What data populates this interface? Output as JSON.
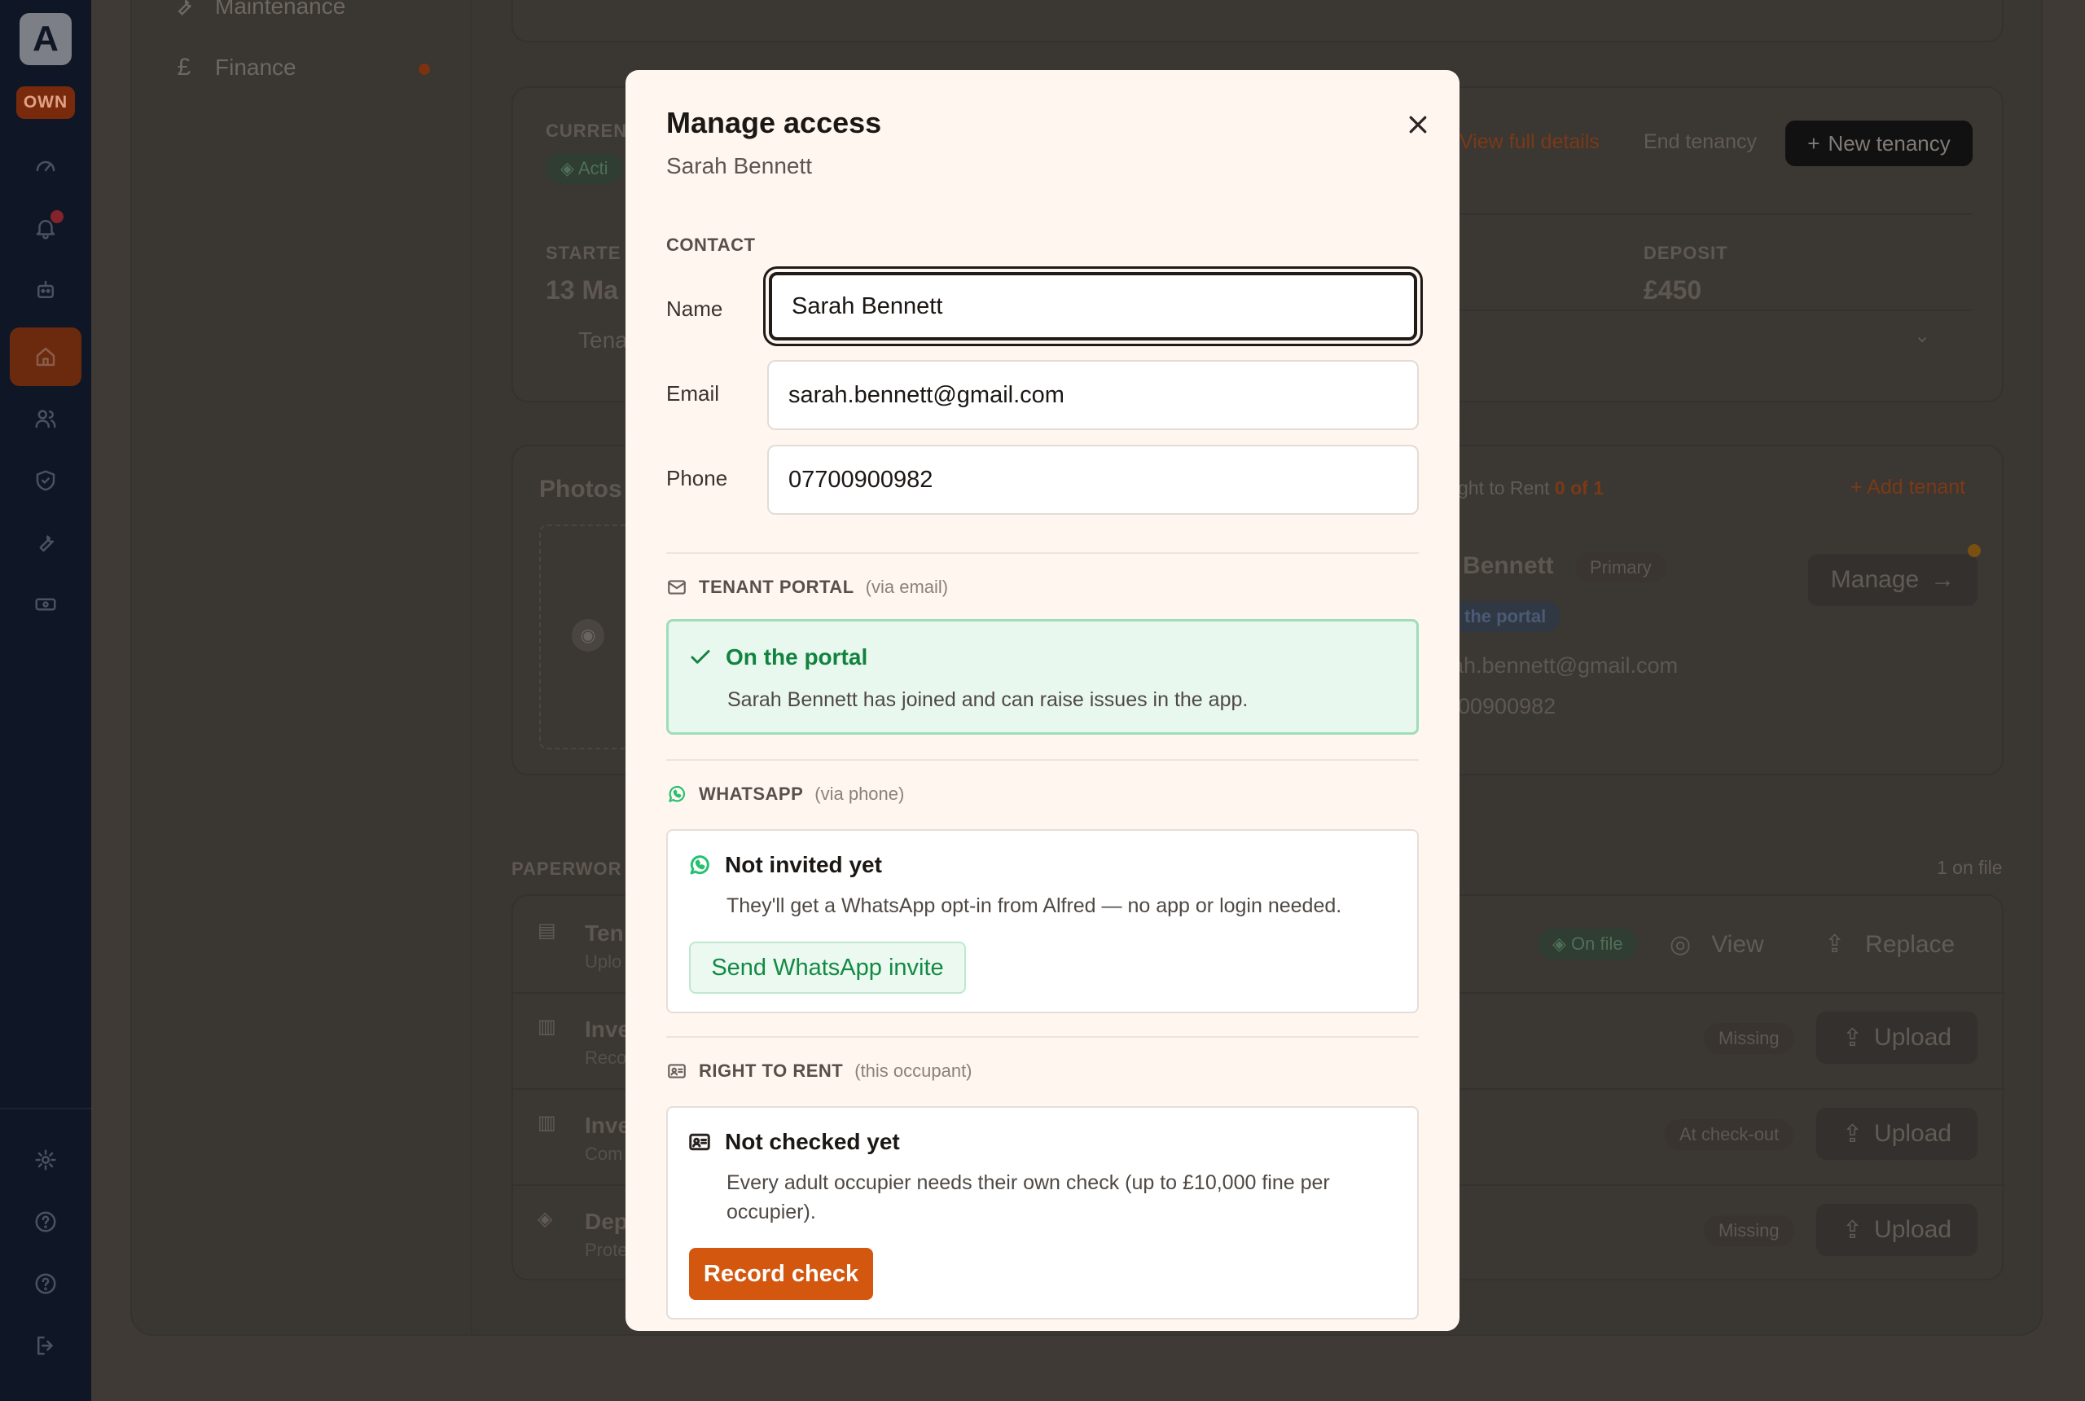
{
  "rail": {
    "logo": "A",
    "badge": "OWN"
  },
  "sidebar": {
    "items": [
      {
        "label": "Maintenance"
      },
      {
        "label": "Finance"
      }
    ]
  },
  "tenancy": {
    "current_label": "CURREN",
    "status": "Acti",
    "started_label": "STARTE",
    "started_value": "13 Ma",
    "deposit_label": "DEPOSIT",
    "deposit_value": "£450",
    "tenant_row": "Tena",
    "view_full_details": "View full details",
    "end_tenancy": "End tenancy",
    "new_tenancy": "New tenancy"
  },
  "photos": {
    "title": "Photos"
  },
  "tenants_card": {
    "right_to_rent_prefix": "ght to Rent",
    "right_to_rent_count": "0 of 1",
    "add_tenant": "Add tenant",
    "name_partial": "Bennett",
    "primary_badge": "Primary",
    "portal_badge": "the portal",
    "email_partial": "ah.bennett@gmail.com",
    "phone_partial": "00900982",
    "manage": "Manage"
  },
  "paperwork": {
    "label": "PAPERWOR",
    "count": "1 on file",
    "rows": [
      {
        "title": "Ten",
        "sub": "Uplo",
        "status": "On file",
        "action1": "View",
        "action2": "Replace"
      },
      {
        "title": "Inve",
        "sub": "Reco",
        "status": "Missing",
        "action": "Upload"
      },
      {
        "title": "Inve",
        "sub": "Com",
        "status": "At check-out",
        "action": "Upload"
      },
      {
        "title": "Dep",
        "sub": "Prote",
        "status": "Missing",
        "action": "Upload"
      }
    ]
  },
  "modal": {
    "title": "Manage access",
    "subtitle": "Sarah Bennett",
    "contact_heading": "CONTACT",
    "fields": {
      "name_label": "Name",
      "name_value": "Sarah Bennett",
      "email_label": "Email",
      "email_value": "sarah.bennett@gmail.com",
      "phone_label": "Phone",
      "phone_value": "07700900982"
    },
    "portal": {
      "heading": "TENANT PORTAL",
      "sub": "(via email)",
      "status_title": "On the portal",
      "status_text": "Sarah Bennett has joined and can raise issues in the app."
    },
    "whatsapp": {
      "heading": "WHATSAPP",
      "sub": "(via phone)",
      "status_title": "Not invited yet",
      "status_text": "They'll get a WhatsApp opt-in from Alfred — no app or login needed.",
      "button": "Send WhatsApp invite"
    },
    "right_to_rent": {
      "heading": "RIGHT TO RENT",
      "sub": "(this occupant)",
      "status_title": "Not checked yet",
      "status_text": "Every adult occupier needs their own check (up to £10,000 fine per occupier).",
      "button": "Record check"
    }
  },
  "colors": {
    "accent": "#d4570f",
    "success": "#138a44",
    "whatsapp": "#25c16f",
    "rail": "#0f1626"
  }
}
